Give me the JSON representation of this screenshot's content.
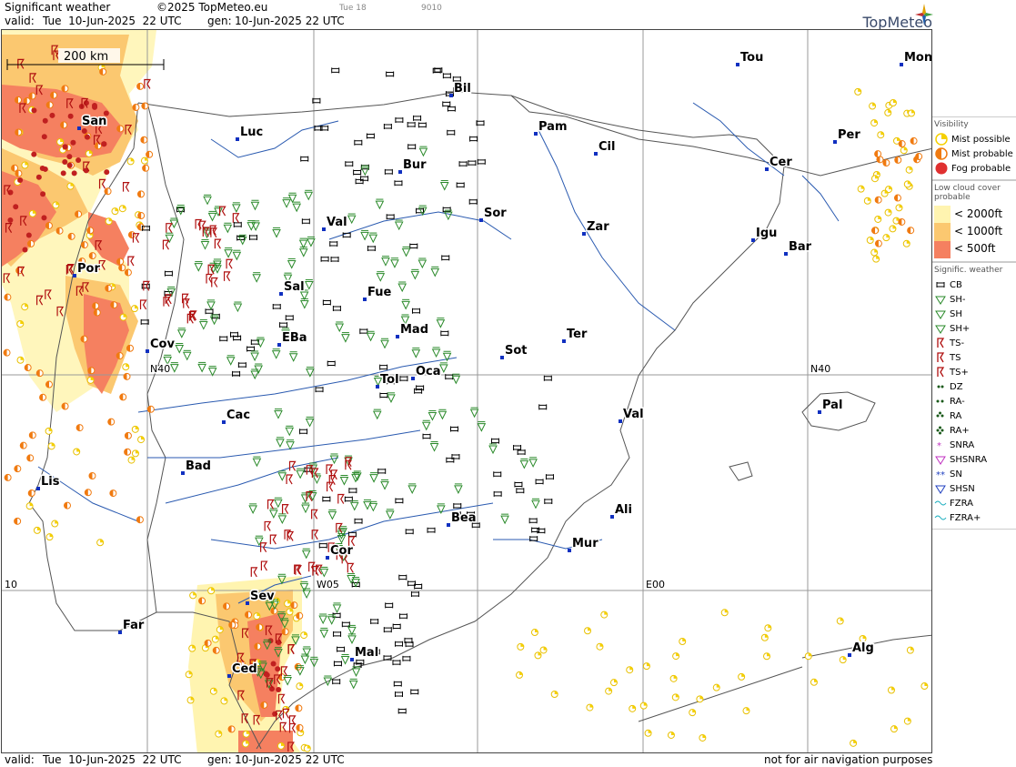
{
  "header": {
    "title": "Significant weather",
    "copyright": "©2025 TopMeteo.eu",
    "valid_label": "valid:",
    "valid_value": "Tue  10-Jun-2025  22 UTC",
    "gen_label": "gen:",
    "gen_value": "10-Jun-2025 22 UTC",
    "faint_day": "Tue 18",
    "faint_code": "9010",
    "brand": "TopMeteo"
  },
  "footer": {
    "valid_label": "valid:",
    "valid_value": "Tue  10-Jun-2025  22 UTC",
    "gen_label": "gen:",
    "gen_value": "10-Jun-2025 22 UTC",
    "disclaimer": "not for air navigation purposes"
  },
  "scale_bar": {
    "label": "200 km"
  },
  "grid_labels": {
    "n40_left": "N40",
    "n40_right": "N40",
    "w10": "10",
    "w05": "W05",
    "e00": "E00"
  },
  "cities": [
    {
      "name": "Tou"
    },
    {
      "name": "Mon"
    },
    {
      "name": "Bil"
    },
    {
      "name": "San"
    },
    {
      "name": "Pam"
    },
    {
      "name": "Luc"
    },
    {
      "name": "Cil"
    },
    {
      "name": "Per"
    },
    {
      "name": "Bur"
    },
    {
      "name": "Cer"
    },
    {
      "name": "Sor"
    },
    {
      "name": "Val"
    },
    {
      "name": "Zar"
    },
    {
      "name": "Igu"
    },
    {
      "name": "Bar"
    },
    {
      "name": "Por"
    },
    {
      "name": "Sal"
    },
    {
      "name": "Fue"
    },
    {
      "name": "Mad"
    },
    {
      "name": "Ter"
    },
    {
      "name": "Cov"
    },
    {
      "name": "EBa"
    },
    {
      "name": "Sot"
    },
    {
      "name": "Tol"
    },
    {
      "name": "Oca"
    },
    {
      "name": "Pal"
    },
    {
      "name": "Cac"
    },
    {
      "name": "Val"
    },
    {
      "name": "Bad"
    },
    {
      "name": "Lis"
    },
    {
      "name": "Bea"
    },
    {
      "name": "Ali"
    },
    {
      "name": "Mur"
    },
    {
      "name": "Cor"
    },
    {
      "name": "Sev"
    },
    {
      "name": "Far"
    },
    {
      "name": "Mal"
    },
    {
      "name": "Alg"
    },
    {
      "name": "Ced"
    }
  ],
  "legend": {
    "visibility": {
      "title": "Visibility",
      "items": [
        {
          "label": "Mist possible",
          "color": "#f5d000"
        },
        {
          "label": "Mist probable",
          "color": "#f07a10"
        },
        {
          "label": "Fog probable",
          "color": "#e03030"
        }
      ]
    },
    "low_cloud": {
      "title": "Low cloud cover probable",
      "items": [
        {
          "label": "< 2000ft",
          "color": "#fff4b0"
        },
        {
          "label": "< 1000ft",
          "color": "#fbc870"
        },
        {
          "label": "<  500ft",
          "color": "#f58060"
        }
      ]
    },
    "signif": {
      "title": "Signific. weather",
      "items": [
        {
          "label": "CB",
          "icon": "cb-icon",
          "color": "#000000"
        },
        {
          "label": "SH-",
          "icon": "shower-light-icon",
          "color": "#2a8a2a"
        },
        {
          "label": "SH",
          "icon": "shower-icon",
          "color": "#2a8a2a"
        },
        {
          "label": "SH+",
          "icon": "shower-heavy-icon",
          "color": "#2a8a2a"
        },
        {
          "label": "TS-",
          "icon": "thunderstorm-light-icon",
          "color": "#b01010"
        },
        {
          "label": "TS",
          "icon": "thunderstorm-icon",
          "color": "#b01010"
        },
        {
          "label": "TS+",
          "icon": "thunderstorm-heavy-icon",
          "color": "#b01010"
        },
        {
          "label": "DZ",
          "icon": "drizzle-icon",
          "color": "#1a5a1a"
        },
        {
          "label": "RA-",
          "icon": "rain-light-icon",
          "color": "#1a5a1a"
        },
        {
          "label": "RA",
          "icon": "rain-icon",
          "color": "#1a5a1a"
        },
        {
          "label": "RA+",
          "icon": "rain-heavy-icon",
          "color": "#1a5a1a"
        },
        {
          "label": "SNRA",
          "icon": "sleet-icon",
          "color": "#c030c0"
        },
        {
          "label": "SHSNRA",
          "icon": "sleet-shower-icon",
          "color": "#c030c0"
        },
        {
          "label": "SN",
          "icon": "snow-icon",
          "color": "#2040c0"
        },
        {
          "label": "SHSN",
          "icon": "snow-shower-icon",
          "color": "#2040c0"
        },
        {
          "label": "FZRA",
          "icon": "freezing-rain-icon",
          "color": "#20b0c0"
        },
        {
          "label": "FZRA+",
          "icon": "freezing-rain-heavy-icon",
          "color": "#20b0c0"
        }
      ]
    }
  }
}
